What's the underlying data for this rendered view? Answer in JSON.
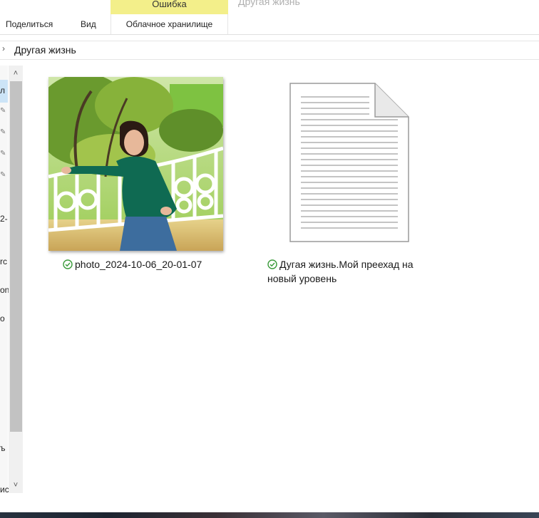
{
  "ribbon": {
    "context_header": "Ошибка",
    "window_title": "Другая жизнь",
    "tabs": [
      {
        "label": "Поделиться"
      },
      {
        "label": "Вид"
      },
      {
        "label": "Облачное хранилище"
      }
    ]
  },
  "address_bar": {
    "path": "Другая жизнь"
  },
  "nav_pane": {
    "fragments": [
      "л",
      "2-",
      "rc",
      "on",
      "o",
      "ъ",
      "иc"
    ]
  },
  "items": [
    {
      "name": "photo_2024-10-06_20-01-07",
      "type": "image",
      "sync_status": "synced"
    },
    {
      "name": "Дугая жизнь.Мой преехад на новый уровень",
      "type": "document",
      "sync_status": "synced"
    }
  ],
  "colors": {
    "context_tab": "#f3ef8a",
    "sync_ok": "#3a9a3a",
    "selection": "#cce4f7"
  }
}
